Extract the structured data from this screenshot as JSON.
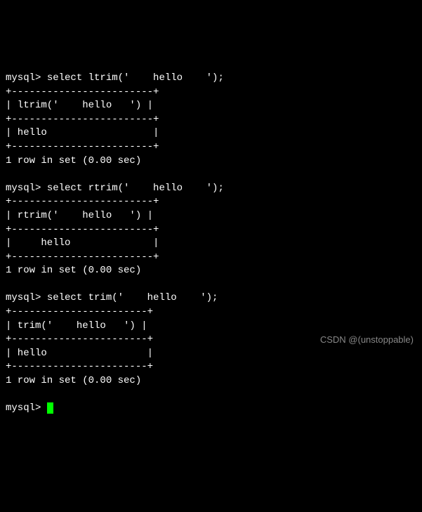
{
  "blocks": [
    {
      "prompt": "mysql> ",
      "query": "select ltrim('    hello    ');",
      "border": "+------------------------+",
      "header": "| ltrim('    hello   ') |",
      "value": "| hello                  |",
      "footer": "1 row in set (0.00 sec)"
    },
    {
      "prompt": "mysql> ",
      "query": "select rtrim('    hello    ');",
      "border": "+------------------------+",
      "header": "| rtrim('    hello   ') |",
      "value": "|     hello              |",
      "footer": "1 row in set (0.00 sec)"
    },
    {
      "prompt": "mysql> ",
      "query": "select trim('    hello    ');",
      "border": "+-----------------------+",
      "header": "| trim('    hello   ') |",
      "value": "| hello                 |",
      "footer": "1 row in set (0.00 sec)"
    }
  ],
  "final_prompt": "mysql> ",
  "watermark": "CSDN @(unstoppable)"
}
